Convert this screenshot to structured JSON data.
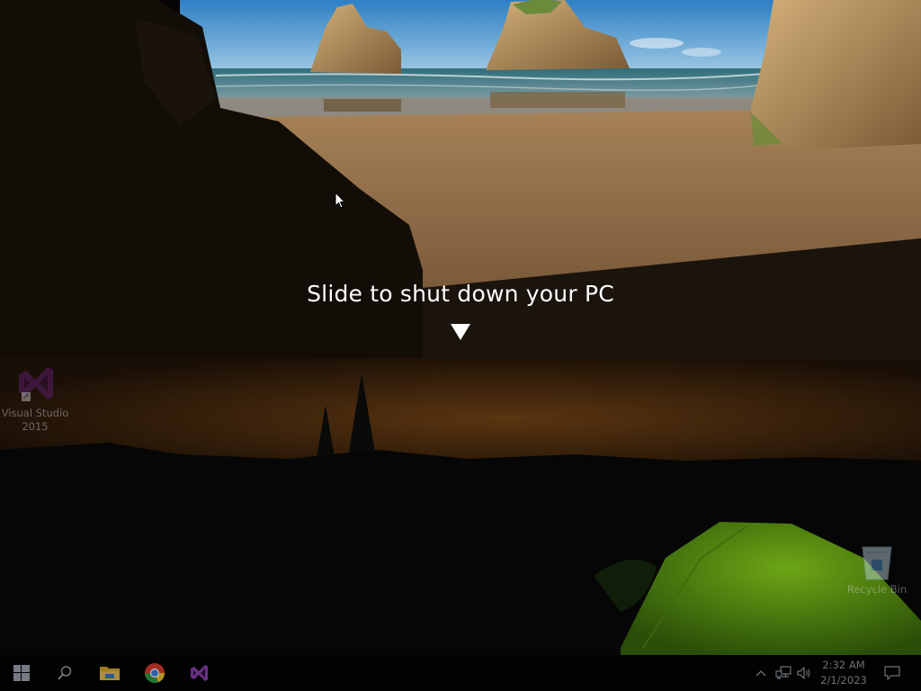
{
  "shutdown": {
    "message": "Slide to shut down your PC",
    "arrow_icon": "down-triangle-icon"
  },
  "desktop": {
    "icons": [
      {
        "name": "visual-studio-2015",
        "line1": "Visual Studio",
        "line2": "2015",
        "icon": "visual-studio-icon"
      },
      {
        "name": "recycle-bin",
        "label": "Recycle Bin",
        "icon": "recycle-bin-icon"
      }
    ]
  },
  "taskbar": {
    "buttons": [
      {
        "name": "start",
        "icon": "windows-logo-icon"
      },
      {
        "name": "search",
        "icon": "search-icon"
      },
      {
        "name": "file-explorer",
        "icon": "folder-icon"
      },
      {
        "name": "chrome",
        "icon": "chrome-icon"
      },
      {
        "name": "visual-studio",
        "icon": "visual-studio-icon"
      }
    ],
    "tray": {
      "chevron_icon": "chevron-up-icon",
      "network_icon": "network-icon",
      "volume_icon": "volume-icon",
      "time": "2:32 AM",
      "date": "2/1/2023",
      "notifications_icon": "action-center-icon"
    }
  },
  "colors": {
    "taskbar": "#020202",
    "vs_purple": "#68217a",
    "folder_yellow": "#e8b33a",
    "tent_green": "#7fc218"
  }
}
